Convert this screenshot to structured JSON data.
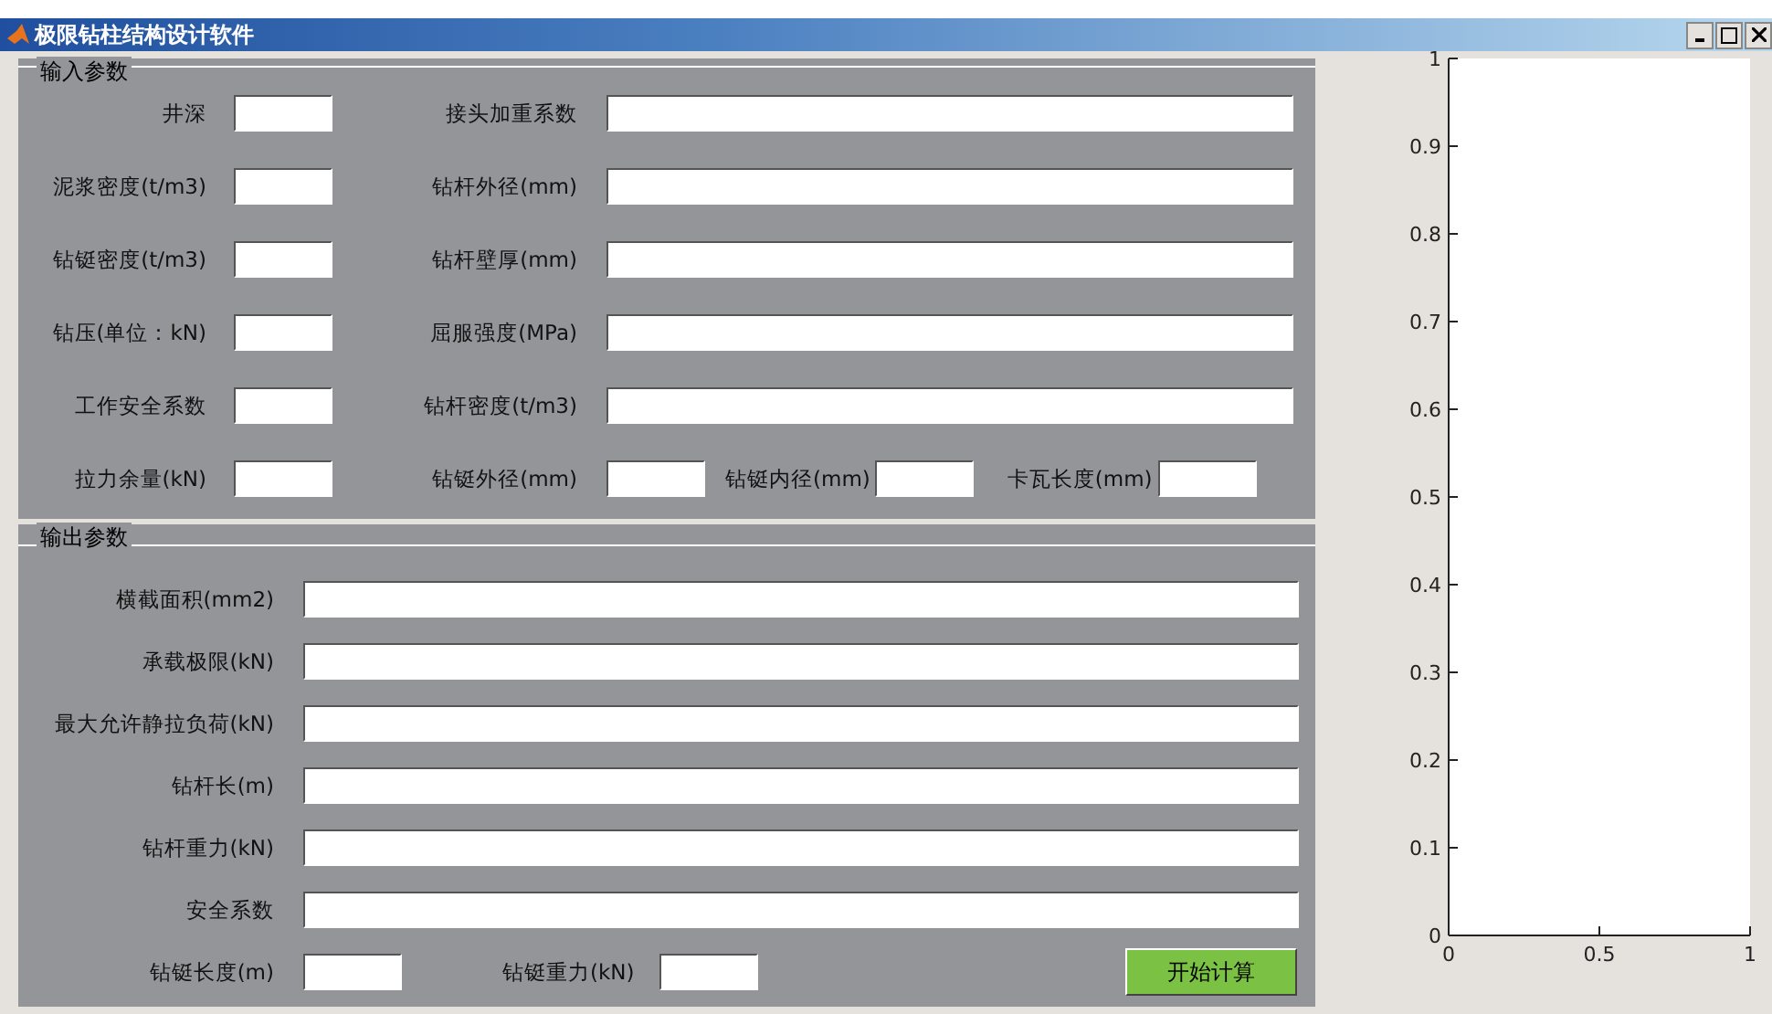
{
  "window": {
    "title": "极限钻柱结构设计软件"
  },
  "input_panel": {
    "title": "输入参数",
    "rows": [
      [
        {
          "label": "井深",
          "kind": "short"
        },
        {
          "label": "接头加重系数",
          "kind": "long"
        }
      ],
      [
        {
          "label": "泥浆密度(t/m3)",
          "kind": "short"
        },
        {
          "label": "钻杆外径(mm)",
          "kind": "long"
        }
      ],
      [
        {
          "label": "钻铤密度(t/m3)",
          "kind": "short"
        },
        {
          "label": "钻杆壁厚(mm)",
          "kind": "long"
        }
      ],
      [
        {
          "label": "钻压(单位：kN)",
          "kind": "short"
        },
        {
          "label": "屈服强度(MPa)",
          "kind": "long"
        }
      ],
      [
        {
          "label": "工作安全系数",
          "kind": "short"
        },
        {
          "label": "钻杆密度(t/m3)",
          "kind": "long"
        }
      ],
      [
        {
          "label": "拉力余量(kN)",
          "kind": "short"
        },
        {
          "label": "钻铤外径(mm)",
          "kind": "short"
        },
        {
          "label": "钻铤内径(mm)",
          "kind": "short"
        },
        {
          "label": "卡瓦长度(mm)",
          "kind": "short"
        }
      ]
    ]
  },
  "output_panel": {
    "title": "输出参数",
    "rows": [
      [
        {
          "label": "横截面积(mm2)",
          "kind": "long"
        }
      ],
      [
        {
          "label": "承载极限(kN)",
          "kind": "long"
        }
      ],
      [
        {
          "label": "最大允许静拉负荷(kN)",
          "kind": "long"
        }
      ],
      [
        {
          "label": "钻杆长(m)",
          "kind": "long"
        }
      ],
      [
        {
          "label": "钻杆重力(kN)",
          "kind": "long"
        }
      ],
      [
        {
          "label": "安全系数",
          "kind": "long"
        }
      ],
      [
        {
          "label": "钻铤长度(m)",
          "kind": "short"
        },
        {
          "label": "钻铤重力(kN)",
          "kind": "short"
        }
      ]
    ],
    "button": "开始计算"
  },
  "chart_data": {
    "type": "line",
    "xlim": [
      0,
      1
    ],
    "ylim": [
      0,
      1
    ],
    "xticks": [
      0,
      0.5,
      1
    ],
    "yticks": [
      0,
      0.1,
      0.2,
      0.3,
      0.4,
      0.5,
      0.6,
      0.7,
      0.8,
      0.9,
      1
    ]
  }
}
